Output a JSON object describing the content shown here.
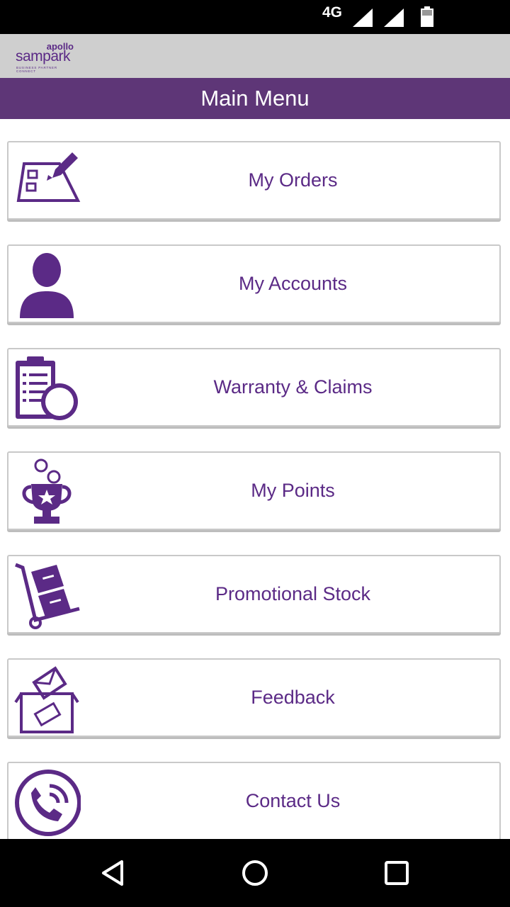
{
  "status_bar": {
    "network": "4G"
  },
  "header": {
    "logo_brand": "apollo",
    "logo_name": "sampark",
    "logo_tagline": "BUSINESS PARTNER CONNECT"
  },
  "title_bar": {
    "title": "Main Menu"
  },
  "menu": {
    "items": [
      {
        "label": "My Orders",
        "icon": "order-form-icon"
      },
      {
        "label": "My Accounts",
        "icon": "user-icon"
      },
      {
        "label": "Warranty & Claims",
        "icon": "clipboard-badge-icon"
      },
      {
        "label": "My Points",
        "icon": "trophy-icon"
      },
      {
        "label": "Promotional Stock",
        "icon": "hand-truck-icon"
      },
      {
        "label": "Feedback",
        "icon": "ballot-box-icon"
      },
      {
        "label": "Contact Us",
        "icon": "phone-icon"
      }
    ]
  },
  "colors": {
    "accent": "#5b2a86",
    "title_bar": "#5e3677",
    "header": "#cfcfcf"
  }
}
